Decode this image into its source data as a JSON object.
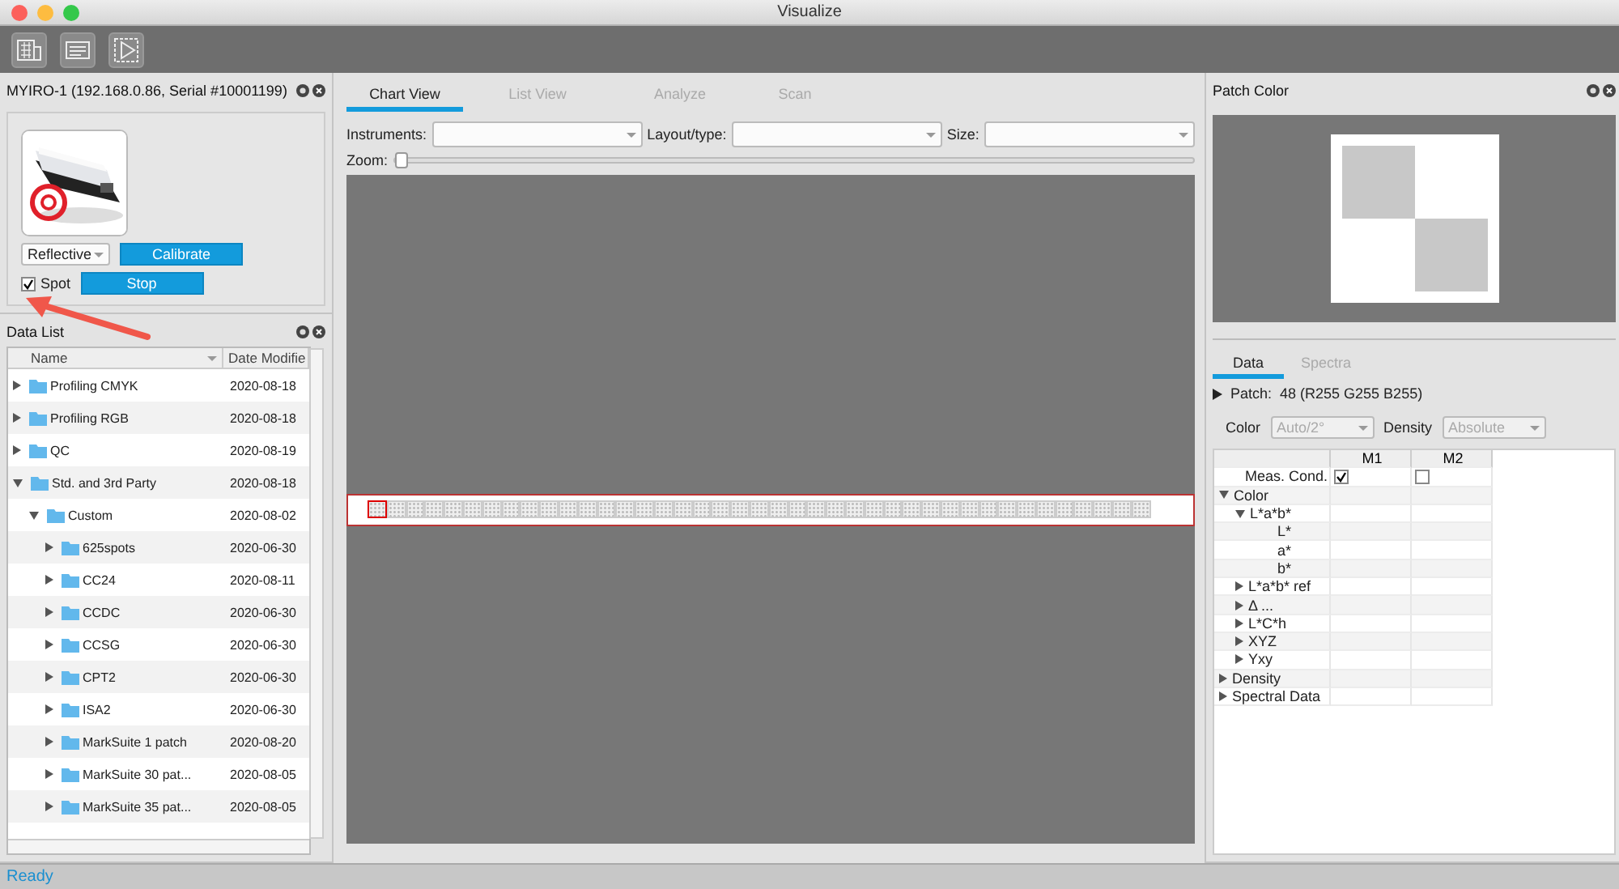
{
  "window": {
    "title": "Visualize"
  },
  "instrument_panel": {
    "title": "MYIRO-1 (192.168.0.86, Serial #10001199)",
    "mode": "Reflective",
    "calibrate": "Calibrate",
    "spot": {
      "label": "Spot",
      "checked": true
    },
    "stop": "Stop"
  },
  "data_list": {
    "title": "Data List",
    "columns": [
      "Name",
      "Date Modifie"
    ],
    "rows": [
      {
        "name": "Profiling CMYK",
        "date": "2020-08-18",
        "expanded": false
      },
      {
        "name": "Profiling RGB",
        "date": "2020-08-18",
        "expanded": false
      },
      {
        "name": "QC",
        "date": "2020-08-19",
        "expanded": false
      },
      {
        "name": "Std. and 3rd Party",
        "date": "2020-08-18",
        "expanded": true,
        "children": [
          {
            "name": "Custom",
            "date": "2020-08-02",
            "expanded": true,
            "children": [
              {
                "name": "625spots",
                "date": "2020-06-30",
                "expanded": false
              },
              {
                "name": "CC24",
                "date": "2020-08-11",
                "expanded": false
              },
              {
                "name": "CCDC",
                "date": "2020-06-30",
                "expanded": false
              },
              {
                "name": "CCSG",
                "date": "2020-06-30",
                "expanded": false
              },
              {
                "name": "CPT2",
                "date": "2020-06-30",
                "expanded": false
              },
              {
                "name": "ISA2",
                "date": "2020-06-30",
                "expanded": false
              },
              {
                "name": "MarkSuite 1 patch",
                "date": "2020-08-20",
                "expanded": false
              },
              {
                "name": "MarkSuite 30 pat...",
                "date": "2020-08-05",
                "expanded": false
              },
              {
                "name": "MarkSuite 35 pat...",
                "date": "2020-08-05",
                "expanded": false
              }
            ]
          }
        ]
      }
    ]
  },
  "chart": {
    "tabs": [
      {
        "label": "Chart View",
        "selected": true
      },
      {
        "label": "List View",
        "selected": false
      },
      {
        "label": "Analyze",
        "selected": false
      },
      {
        "label": "Scan",
        "selected": false
      }
    ],
    "filters": [
      {
        "label": "Instruments:"
      },
      {
        "label": "Layout/type:"
      },
      {
        "label": "Size:"
      }
    ],
    "zoom": {
      "label": "Zoom:",
      "level": 0
    },
    "patches": [
      {
        "selected": true
      },
      {
        "selected": false
      },
      {
        "selected": false
      },
      {
        "selected": false
      },
      {
        "selected": false
      },
      {
        "selected": false
      },
      {
        "selected": false
      },
      {
        "selected": false
      },
      {
        "selected": false
      },
      {
        "selected": false
      },
      {
        "selected": false
      },
      {
        "selected": false
      },
      {
        "selected": false
      },
      {
        "selected": false
      },
      {
        "selected": false
      },
      {
        "selected": false
      },
      {
        "selected": false
      },
      {
        "selected": false
      },
      {
        "selected": false
      },
      {
        "selected": false
      },
      {
        "selected": false
      },
      {
        "selected": false
      },
      {
        "selected": false
      },
      {
        "selected": false
      },
      {
        "selected": false
      },
      {
        "selected": false
      },
      {
        "selected": false
      },
      {
        "selected": false
      },
      {
        "selected": false
      },
      {
        "selected": false
      },
      {
        "selected": false
      },
      {
        "selected": false
      },
      {
        "selected": false
      },
      {
        "selected": false
      },
      {
        "selected": false
      },
      {
        "selected": false
      },
      {
        "selected": false
      },
      {
        "selected": false
      },
      {
        "selected": false
      },
      {
        "selected": false
      },
      {
        "selected": false
      }
    ]
  },
  "patch_color": {
    "title": "Patch Color",
    "tabs": [
      {
        "label": "Data",
        "selected": true
      },
      {
        "label": "Spectra",
        "selected": false
      }
    ],
    "patch_label": "Patch:",
    "patch_value": "48 (R255 G255 B255)",
    "color": {
      "label": "Color",
      "value": "Auto/2°",
      "disabled": true
    },
    "density": {
      "label": "Density",
      "value": "Absolute",
      "disabled": true
    },
    "columns": [
      "M1",
      "M2"
    ],
    "rows": [
      {
        "label": "Meas. Cond.",
        "m1": true,
        "m2": false
      },
      {
        "label": "Color",
        "expanded": true,
        "children": [
          {
            "label": "L*a*b*",
            "expanded": true,
            "children": [
              {
                "label": "L*"
              },
              {
                "label": "a*"
              },
              {
                "label": "b*"
              }
            ]
          },
          {
            "label": "L*a*b* ref",
            "expanded": false
          },
          {
            "label": "Δ ...",
            "expanded": false
          },
          {
            "label": "L*C*h",
            "expanded": false
          },
          {
            "label": "XYZ",
            "expanded": false
          },
          {
            "label": "Yxy",
            "expanded": false
          }
        ]
      },
      {
        "label": "Density",
        "expanded": false
      },
      {
        "label": "Spectral Data",
        "expanded": false
      }
    ]
  },
  "status_bar": {
    "text": "Ready"
  }
}
